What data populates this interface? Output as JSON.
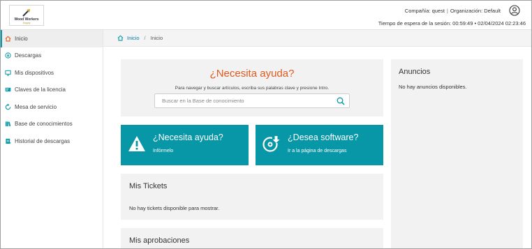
{
  "header": {
    "logo": {
      "name": "Wood Workers",
      "sub": "Supply"
    },
    "company_label": "Compañía: quest",
    "org_label": "Organización: Default",
    "session": "Tiempo de espera de la sesión: 00:59:49 • 02/04/2024 02:23:46"
  },
  "sidebar": {
    "items": [
      {
        "label": "Inicio",
        "icon": "home-icon"
      },
      {
        "label": "Descargas",
        "icon": "download-icon"
      },
      {
        "label": "Mis dispositivos",
        "icon": "monitor-icon"
      },
      {
        "label": "Claves de la licencia",
        "icon": "key-card-icon"
      },
      {
        "label": "Mesa de servicio",
        "icon": "refresh-icon"
      },
      {
        "label": "Base de conocimientos",
        "icon": "books-icon"
      },
      {
        "label": "Historial de descargas",
        "icon": "history-icon"
      }
    ]
  },
  "breadcrumb": {
    "home": "Inicio",
    "current": "Inicio"
  },
  "help": {
    "title": "¿Necesita ayuda?",
    "subtitle": "Para navegar y buscar artículos, escriba sus palabras clave y presione Intro.",
    "search_placeholder": "Buscar en la Base de conocimiento"
  },
  "tiles": [
    {
      "title": "¿Necesita ayuda?",
      "sub": "Infórmelo",
      "icon": "warning-icon"
    },
    {
      "title": "¿Desea software?",
      "sub": "Ir a la página de descargas",
      "icon": "disc-download-icon"
    }
  ],
  "tickets": {
    "title": "Mis Tickets",
    "empty": "No hay tickets disponible para mostrar."
  },
  "approvals": {
    "title": "Mis aprobaciones"
  },
  "announcements": {
    "title": "Anuncios",
    "empty": "No hay anuncios disponibles."
  },
  "colors": {
    "accent": "#0797a6",
    "help_title": "#e05a1e",
    "panel": "#f2f2f2"
  }
}
